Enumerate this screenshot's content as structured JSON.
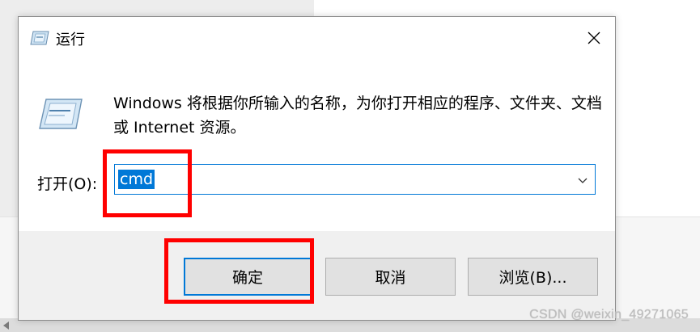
{
  "window": {
    "title": "运行",
    "description": "Windows 将根据你所输入的名称，为你打开相应的程序、文件夹、文档或 Internet 资源。"
  },
  "open_field": {
    "label": "打开(O):",
    "value": "cmd"
  },
  "buttons": {
    "ok": "确定",
    "cancel": "取消",
    "browse": "浏览(B)..."
  },
  "watermark": "CSDN @weixin_49271065",
  "colors": {
    "accent": "#0078d7",
    "annotation": "#ff0000"
  },
  "icons": {
    "title": "run-icon",
    "content": "run-icon",
    "close": "close-icon",
    "dropdown": "chevron-down-icon"
  }
}
